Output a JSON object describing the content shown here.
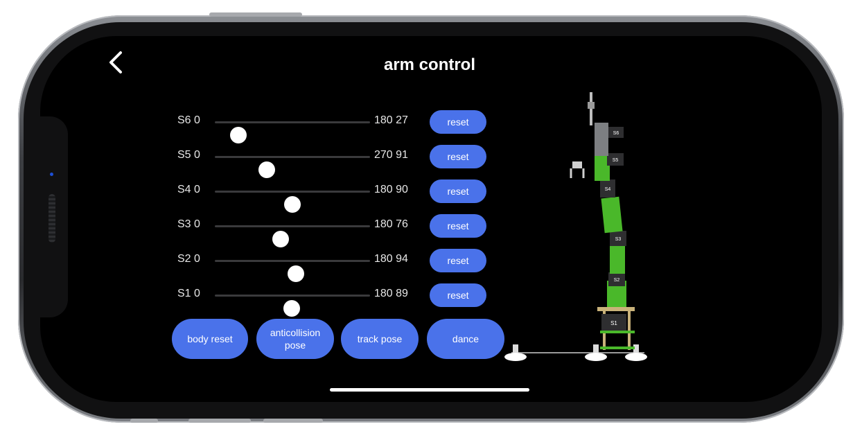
{
  "header": {
    "title": "arm control",
    "back_icon": "chevron-left-icon"
  },
  "sliders": [
    {
      "name": "S6",
      "min": "0",
      "max": "180",
      "value": "27",
      "max_value": 180,
      "current": 27,
      "reset_label": "reset"
    },
    {
      "name": "S5",
      "min": "0",
      "max": "270",
      "value": "91",
      "max_value": 270,
      "current": 91,
      "reset_label": "reset"
    },
    {
      "name": "S4",
      "min": "0",
      "max": "180",
      "value": "90",
      "max_value": 180,
      "current": 90,
      "reset_label": "reset"
    },
    {
      "name": "S3",
      "min": "0",
      "max": "180",
      "value": "76",
      "max_value": 180,
      "current": 76,
      "reset_label": "reset"
    },
    {
      "name": "S2",
      "min": "0",
      "max": "180",
      "value": "94",
      "max_value": 180,
      "current": 94,
      "reset_label": "reset"
    },
    {
      "name": "S1",
      "min": "0",
      "max": "180",
      "value": "89",
      "max_value": 180,
      "current": 89,
      "reset_label": "reset"
    }
  ],
  "actions": [
    {
      "label": "body reset"
    },
    {
      "label": "anticollision pose"
    },
    {
      "label": "track pose"
    },
    {
      "label": "dance"
    }
  ],
  "robot": {
    "joint_labels": [
      "S6",
      "S5",
      "S4",
      "S3",
      "S2",
      "S1"
    ],
    "colors": {
      "frame": "#4ab82a",
      "servo": "#2e2e30",
      "base": "#c9b27a",
      "accent": "#4a72ea"
    }
  }
}
